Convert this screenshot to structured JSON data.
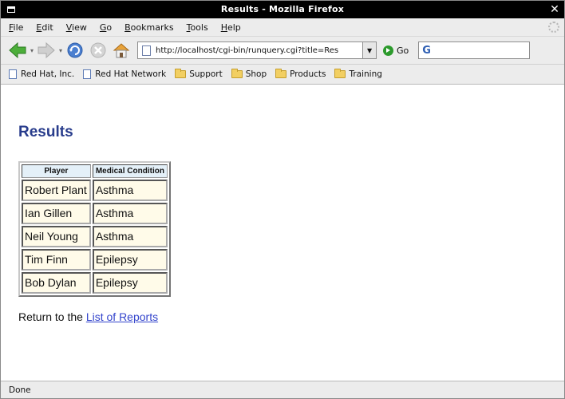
{
  "window": {
    "title": "Results - Mozilla Firefox"
  },
  "menubar": {
    "items": [
      {
        "first": "F",
        "rest": "ile"
      },
      {
        "first": "E",
        "rest": "dit"
      },
      {
        "first": "V",
        "rest": "iew"
      },
      {
        "first": "G",
        "rest": "o"
      },
      {
        "first": "B",
        "rest": "ookmarks"
      },
      {
        "first": "T",
        "rest": "ools"
      },
      {
        "first": "H",
        "rest": "elp"
      }
    ]
  },
  "navbar": {
    "url": "http://localhost/cgi-bin/runquery.cgi?title=Res",
    "go_label": "Go",
    "search_engine_glyph": "G"
  },
  "bookmarks": [
    {
      "label": "Red Hat, Inc.",
      "kind": "page"
    },
    {
      "label": "Red Hat Network",
      "kind": "page"
    },
    {
      "label": "Support",
      "kind": "folder"
    },
    {
      "label": "Shop",
      "kind": "folder"
    },
    {
      "label": "Products",
      "kind": "folder"
    },
    {
      "label": "Training",
      "kind": "folder"
    }
  ],
  "page": {
    "heading": "Results",
    "table": {
      "headers": [
        "Player",
        "Medical Condition"
      ],
      "rows": [
        [
          "Robert Plant",
          "Asthma"
        ],
        [
          "Ian Gillen",
          "Asthma"
        ],
        [
          "Neil Young",
          "Asthma"
        ],
        [
          "Tim Finn",
          "Epilepsy"
        ],
        [
          "Bob Dylan",
          "Epilepsy"
        ]
      ]
    },
    "return_prefix": "Return to the ",
    "return_link": "List of Reports"
  },
  "status": {
    "text": "Done"
  },
  "colors": {
    "heading": "#283c8c",
    "link": "#3344cc",
    "header_cell": "#e4f0f8",
    "data_cell": "#fffbe9"
  }
}
